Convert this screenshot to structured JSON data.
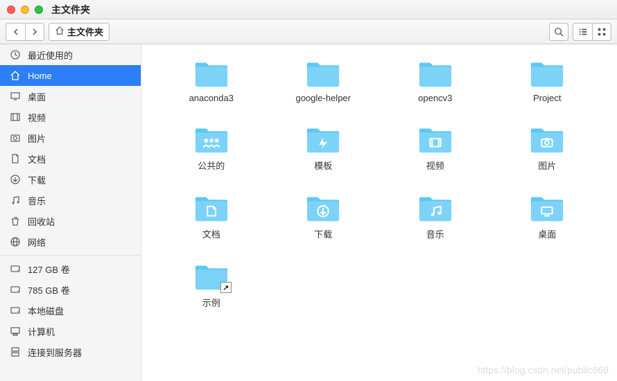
{
  "window_title": "主文件夹",
  "path_label": "主文件夹",
  "sidebar": {
    "groups": [
      [
        {
          "icon": "clock-icon",
          "label": "最近使用的"
        },
        {
          "icon": "home-icon",
          "label": "Home",
          "active": true
        },
        {
          "icon": "desktop-icon",
          "label": "桌面"
        },
        {
          "icon": "video-icon",
          "label": "视频"
        },
        {
          "icon": "photo-icon",
          "label": "图片"
        },
        {
          "icon": "document-icon",
          "label": "文档"
        },
        {
          "icon": "download-icon",
          "label": "下载"
        },
        {
          "icon": "music-icon",
          "label": "音乐"
        },
        {
          "icon": "trash-icon",
          "label": "回收站"
        },
        {
          "icon": "network-icon",
          "label": "网络"
        }
      ],
      [
        {
          "icon": "disk-icon",
          "label": "127 GB 卷"
        },
        {
          "icon": "disk-icon",
          "label": "785 GB 卷"
        },
        {
          "icon": "disk-icon",
          "label": "本地磁盘"
        },
        {
          "icon": "computer-icon",
          "label": "计算机"
        },
        {
          "icon": "server-icon",
          "label": "连接到服务器"
        }
      ]
    ]
  },
  "folders": [
    {
      "label": "anaconda3",
      "type": "plain"
    },
    {
      "label": "google-helper",
      "type": "plain"
    },
    {
      "label": "opencv3",
      "type": "plain"
    },
    {
      "label": "Project",
      "type": "plain"
    },
    {
      "label": "公共的",
      "type": "public"
    },
    {
      "label": "模板",
      "type": "templates"
    },
    {
      "label": "视频",
      "type": "videos"
    },
    {
      "label": "图片",
      "type": "pictures"
    },
    {
      "label": "文档",
      "type": "documents"
    },
    {
      "label": "下载",
      "type": "downloads"
    },
    {
      "label": "音乐",
      "type": "music"
    },
    {
      "label": "桌面",
      "type": "desktop"
    },
    {
      "label": "示例",
      "type": "plain",
      "link": true
    }
  ],
  "watermark": "https://blog.csdn.net/public669"
}
